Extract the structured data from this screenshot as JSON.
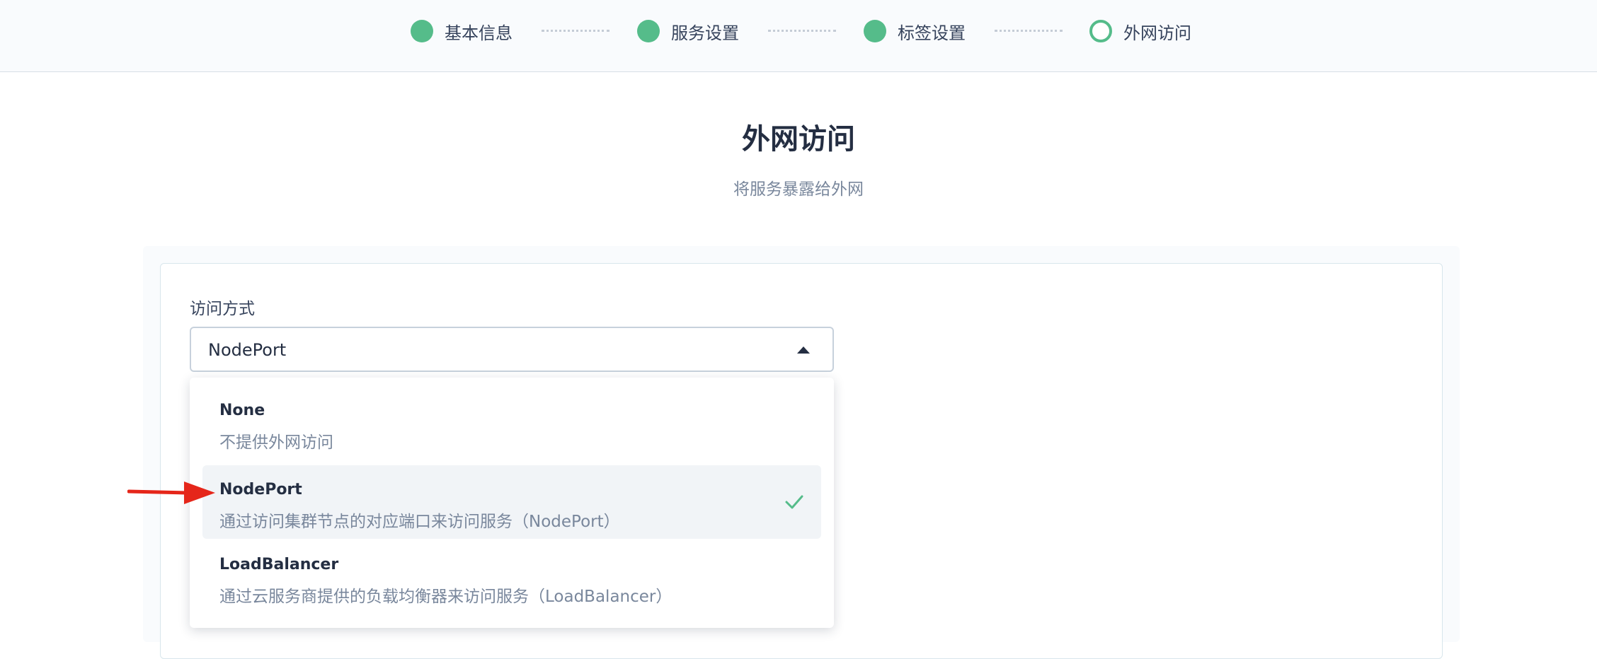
{
  "steps": [
    {
      "label": "基本信息",
      "state": "completed"
    },
    {
      "label": "服务设置",
      "state": "completed"
    },
    {
      "label": "标签设置",
      "state": "completed"
    },
    {
      "label": "外网访问",
      "state": "current"
    }
  ],
  "page": {
    "title": "外网访问",
    "subtitle": "将服务暴露给外网"
  },
  "form": {
    "access_mode_label": "访问方式",
    "access_mode_value": "NodePort",
    "options": [
      {
        "title": "None",
        "description": "不提供外网访问",
        "selected": false
      },
      {
        "title": "NodePort",
        "description": "通过访问集群节点的对应端口来访问服务（NodePort）",
        "selected": true
      },
      {
        "title": "LoadBalancer",
        "description": "通过云服务商提供的负载均衡器来访问服务（LoadBalancer）",
        "selected": false
      }
    ]
  },
  "colors": {
    "accent_green": "#55bc8a",
    "annotation_red": "#e5261a"
  },
  "icons": {
    "select_caret": "caret-up-icon",
    "selected_check": "check-icon",
    "annotation": "red-arrow-annotation"
  }
}
